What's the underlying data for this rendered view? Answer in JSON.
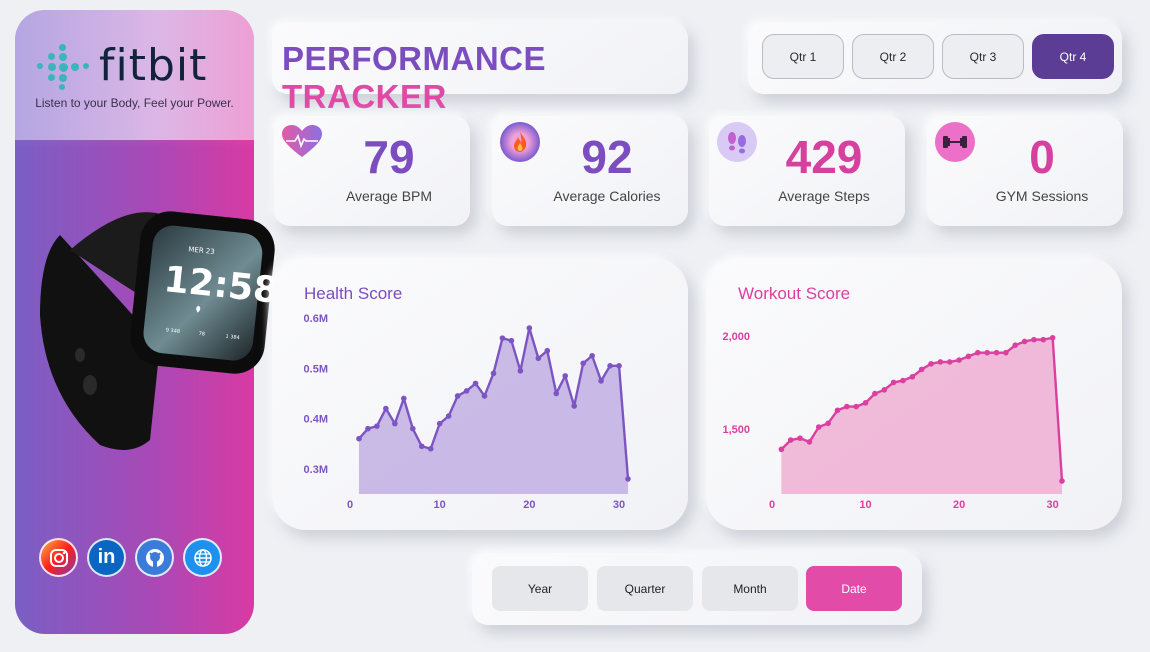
{
  "brand": {
    "name": "fitbit",
    "tagline": "Listen to your Body, Feel your Power."
  },
  "watch_screen": {
    "date": "MER 23",
    "time": "12:58",
    "stat_1": "9 348",
    "stat_2": "78",
    "stat_3": "1 384"
  },
  "socials": [
    {
      "name": "instagram",
      "icon": "instagram-icon"
    },
    {
      "name": "linkedin",
      "icon": "linkedin-icon",
      "glyph": "in"
    },
    {
      "name": "github",
      "icon": "github-icon"
    },
    {
      "name": "website",
      "icon": "globe-icon"
    }
  ],
  "title": {
    "part1": "PERFORMANCE",
    "part2": "TRACKER"
  },
  "quarters": {
    "items": [
      "Qtr 1",
      "Qtr 2",
      "Qtr 3",
      "Qtr 4"
    ],
    "selected": "Qtr 4"
  },
  "kpis": [
    {
      "value": "79",
      "label": "Average BPM",
      "icon": "heart-rate-icon",
      "color": "#7b4dbf"
    },
    {
      "value": "92",
      "label": "Average Calories",
      "icon": "calories-flame-icon",
      "color": "#7b4dbf"
    },
    {
      "value": "429",
      "label": "Average Steps",
      "icon": "footsteps-icon",
      "color": "#d6409f"
    },
    {
      "value": "0",
      "label": "GYM Sessions",
      "icon": "dumbbell-icon",
      "color": "#d6409f"
    }
  ],
  "granularity": {
    "items": [
      "Year",
      "Quarter",
      "Month",
      "Date"
    ],
    "selected": "Date"
  },
  "chart_data": [
    {
      "type": "area",
      "title": "Health Score",
      "color": "#7c55c2",
      "fill": "#c4b3e3",
      "x": [
        1,
        2,
        3,
        4,
        5,
        6,
        7,
        8,
        9,
        10,
        11,
        12,
        13,
        14,
        15,
        16,
        17,
        18,
        19,
        20,
        21,
        22,
        23,
        24,
        25,
        26,
        27,
        28,
        29,
        30,
        31
      ],
      "values": [
        0.36,
        0.38,
        0.385,
        0.42,
        0.39,
        0.44,
        0.38,
        0.345,
        0.34,
        0.39,
        0.405,
        0.445,
        0.455,
        0.47,
        0.445,
        0.49,
        0.56,
        0.555,
        0.495,
        0.58,
        0.52,
        0.535,
        0.45,
        0.485,
        0.425,
        0.51,
        0.525,
        0.475,
        0.505,
        0.505,
        0.28
      ],
      "xticks": [
        "0",
        "10",
        "20",
        "30"
      ],
      "yticks": [
        "0.3M",
        "0.4M",
        "0.5M",
        "0.6M"
      ],
      "xlim": [
        0,
        31
      ],
      "ylim": [
        0.25,
        0.62
      ]
    },
    {
      "type": "area",
      "title": "Workout Score",
      "color": "#db3fa0",
      "fill": "#f0b3d5",
      "x": [
        1,
        2,
        3,
        4,
        5,
        6,
        7,
        8,
        9,
        10,
        11,
        12,
        13,
        14,
        15,
        16,
        17,
        18,
        19,
        20,
        21,
        22,
        23,
        24,
        25,
        26,
        27,
        28,
        29,
        30,
        31
      ],
      "values": [
        1390,
        1440,
        1450,
        1430,
        1510,
        1530,
        1600,
        1620,
        1620,
        1640,
        1690,
        1710,
        1750,
        1760,
        1780,
        1820,
        1850,
        1860,
        1860,
        1870,
        1890,
        1910,
        1910,
        1910,
        1910,
        1950,
        1970,
        1980,
        1980,
        1990,
        1220
      ],
      "xticks": [
        "0",
        "10",
        "20",
        "30"
      ],
      "yticks": [
        "1,500",
        "2,000"
      ],
      "xlim": [
        0,
        31
      ],
      "ylim": [
        1150,
        2150
      ]
    }
  ]
}
